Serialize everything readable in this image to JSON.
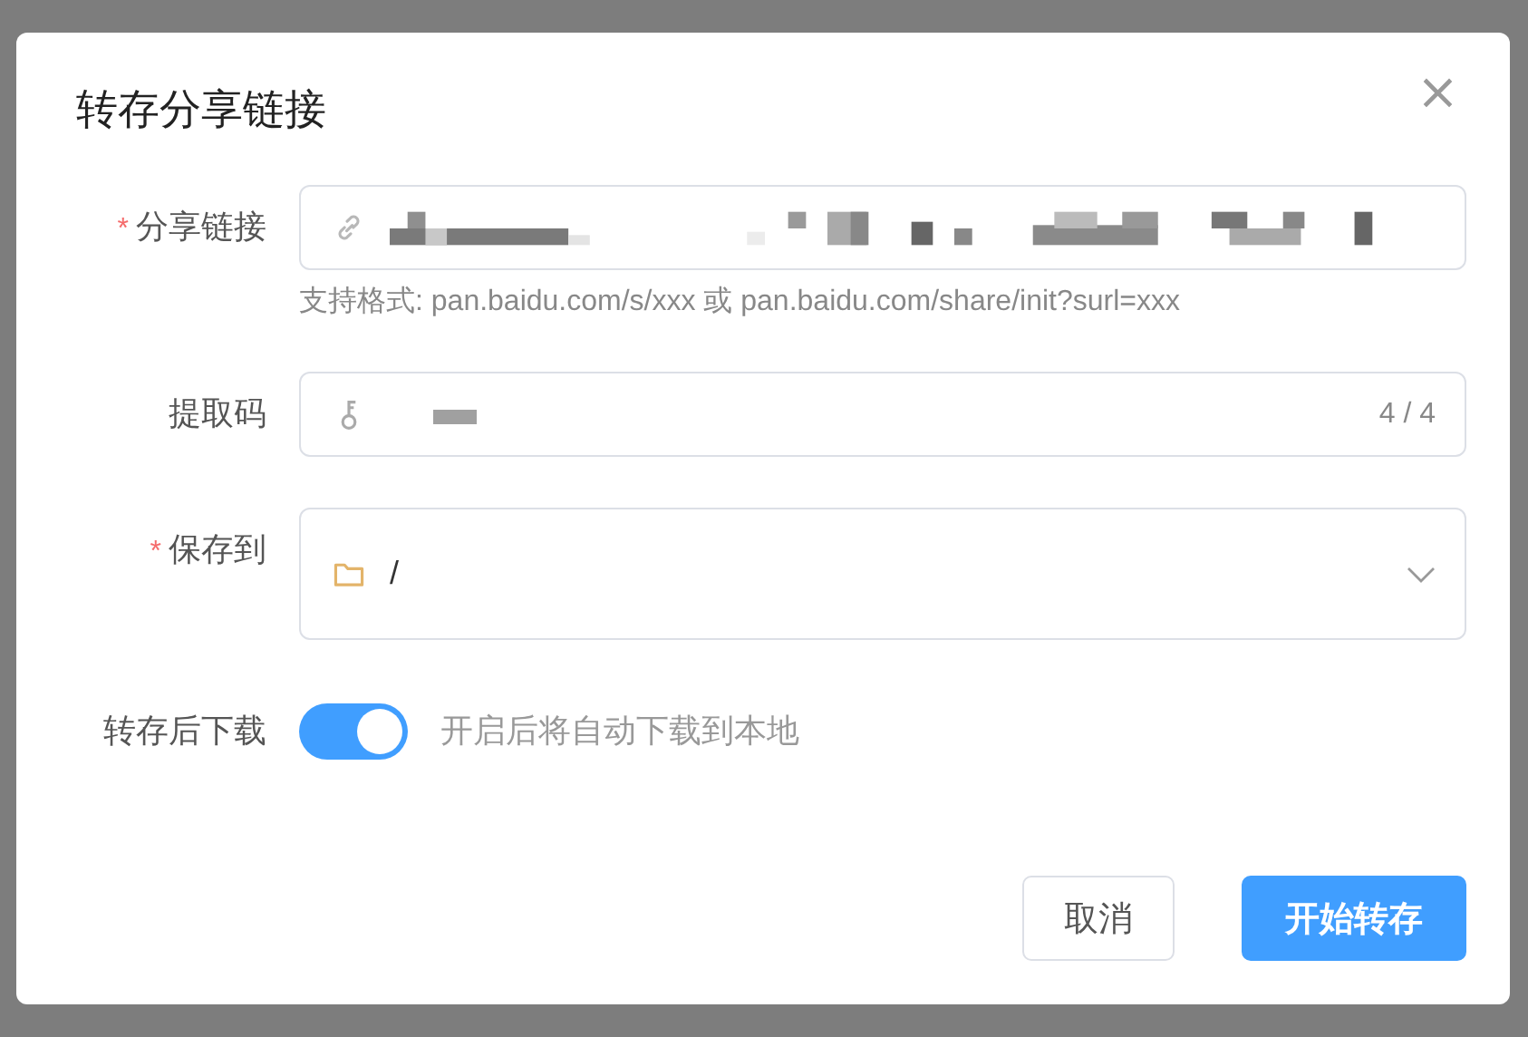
{
  "dialog": {
    "title": "转存分享链接",
    "close": "×"
  },
  "fields": [
    {
      "kind": "text",
      "label": "分享链接",
      "required_mark": "*",
      "hint": "支持格式: pan.baidu.com/s/xxx 或 pan.baidu.com/share/init?surl=xxx"
    },
    {
      "kind": "password",
      "label": "提取码",
      "counter": "4 / 4"
    },
    {
      "kind": "select",
      "label": "保存到",
      "required_mark": "*",
      "value": "/"
    },
    {
      "kind": "switch",
      "label": "转存后下载",
      "on": true,
      "note": "开启后将自动下载到本地"
    }
  ],
  "buttons": [
    {
      "label": "取消",
      "kind": "default"
    },
    {
      "label": "开始转存",
      "kind": "primary"
    }
  ]
}
